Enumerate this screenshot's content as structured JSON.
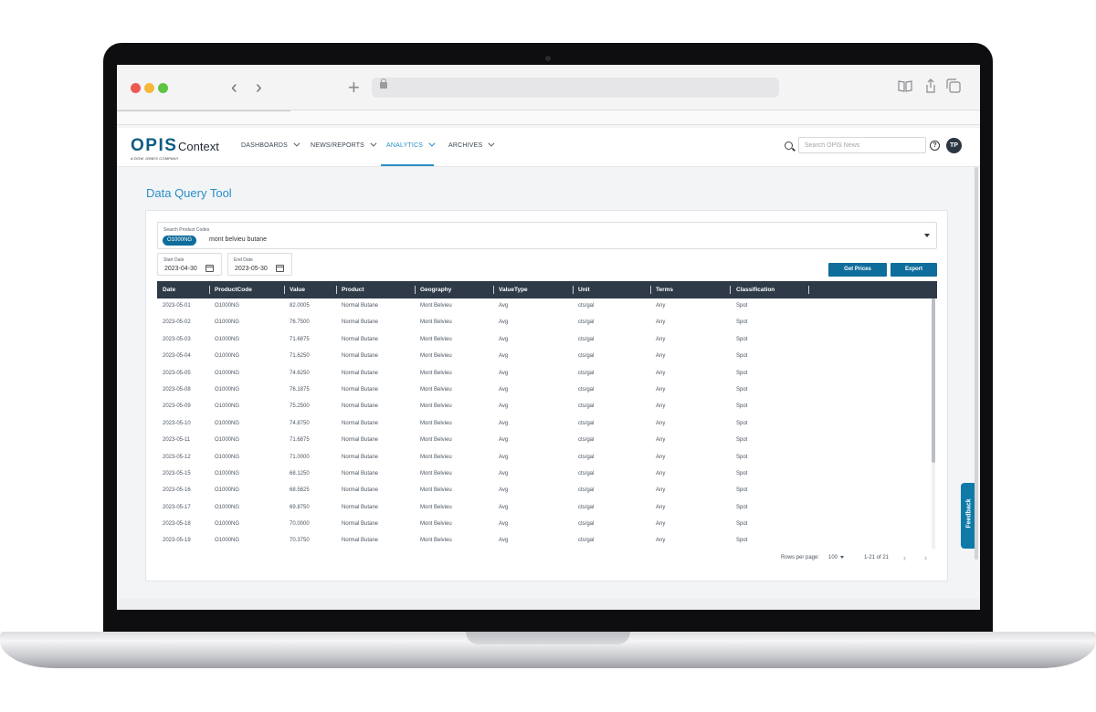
{
  "brand": {
    "logo": "OPIS",
    "logo_sub": "A DOW JONES COMPANY",
    "app_name": "Context"
  },
  "nav": [
    {
      "label": "DASHBOARDS",
      "active": false
    },
    {
      "label": "NEWS/REPORTS",
      "active": false
    },
    {
      "label": "ANALYTICS",
      "active": true
    },
    {
      "label": "ARCHIVES",
      "active": false
    }
  ],
  "header": {
    "search_placeholder": "Search OPIS News",
    "help": "?",
    "user_initials": "TP"
  },
  "page": {
    "title": "Data Query Tool"
  },
  "product_select": {
    "label": "Search Product Codes",
    "chip": "O1000NG",
    "text": "mont belvieu butane"
  },
  "start_date": {
    "label": "Start Date",
    "value": "2023-04-30"
  },
  "end_date": {
    "label": "End Date",
    "value": "2023-05-30"
  },
  "buttons": {
    "get_prices": "Get Prices",
    "export": "Export"
  },
  "table": {
    "columns": [
      "Date",
      "ProductCode",
      "Value",
      "Product",
      "Geography",
      "ValueType",
      "Unit",
      "Terms",
      "Classification"
    ],
    "rows": [
      [
        "2023-05-01",
        "O1000NG",
        "82.0005",
        "Normal Butane",
        "Mont Belvieu",
        "Avg",
        "cts/gal",
        "Any",
        "Spot"
      ],
      [
        "2023-05-02",
        "O1000NG",
        "76.7500",
        "Normal Butane",
        "Mont Belvieu",
        "Avg",
        "cts/gal",
        "Any",
        "Spot"
      ],
      [
        "2023-05-03",
        "O1000NG",
        "71.6875",
        "Normal Butane",
        "Mont Belvieu",
        "Avg",
        "cts/gal",
        "Any",
        "Spot"
      ],
      [
        "2023-05-04",
        "O1000NG",
        "71.6250",
        "Normal Butane",
        "Mont Belvieu",
        "Avg",
        "cts/gal",
        "Any",
        "Spot"
      ],
      [
        "2023-05-05",
        "O1000NG",
        "74.6250",
        "Normal Butane",
        "Mont Belvieu",
        "Avg",
        "cts/gal",
        "Any",
        "Spot"
      ],
      [
        "2023-05-08",
        "O1000NG",
        "76.1875",
        "Normal Butane",
        "Mont Belvieu",
        "Avg",
        "cts/gal",
        "Any",
        "Spot"
      ],
      [
        "2023-05-09",
        "O1000NG",
        "75.2500",
        "Normal Butane",
        "Mont Belvieu",
        "Avg",
        "cts/gal",
        "Any",
        "Spot"
      ],
      [
        "2023-05-10",
        "O1000NG",
        "74.8750",
        "Normal Butane",
        "Mont Belvieu",
        "Avg",
        "cts/gal",
        "Any",
        "Spot"
      ],
      [
        "2023-05-11",
        "O1000NG",
        "71.6875",
        "Normal Butane",
        "Mont Belvieu",
        "Avg",
        "cts/gal",
        "Any",
        "Spot"
      ],
      [
        "2023-05-12",
        "O1000NG",
        "71.0000",
        "Normal Butane",
        "Mont Belvieu",
        "Avg",
        "cts/gal",
        "Any",
        "Spot"
      ],
      [
        "2023-05-15",
        "O1000NG",
        "68.1250",
        "Normal Butane",
        "Mont Belvieu",
        "Avg",
        "cts/gal",
        "Any",
        "Spot"
      ],
      [
        "2023-05-16",
        "O1000NG",
        "68.5625",
        "Normal Butane",
        "Mont Belvieu",
        "Avg",
        "cts/gal",
        "Any",
        "Spot"
      ],
      [
        "2023-05-17",
        "O1000NG",
        "69.8750",
        "Normal Butane",
        "Mont Belvieu",
        "Avg",
        "cts/gal",
        "Any",
        "Spot"
      ],
      [
        "2023-05-18",
        "O1000NG",
        "70.0000",
        "Normal Butane",
        "Mont Belvieu",
        "Avg",
        "cts/gal",
        "Any",
        "Spot"
      ],
      [
        "2023-05-19",
        "O1000NG",
        "70.3750",
        "Normal Butane",
        "Mont Belvieu",
        "Avg",
        "cts/gal",
        "Any",
        "Spot"
      ]
    ]
  },
  "pagination": {
    "rows_label": "Rows per page:",
    "rows_value": "100",
    "range": "1-21 of 21"
  },
  "feedback": {
    "label": "Feedback"
  },
  "colors": {
    "primary": "#0f6d9b",
    "accent": "#2a8fc7",
    "table_header": "#2e3a48"
  }
}
